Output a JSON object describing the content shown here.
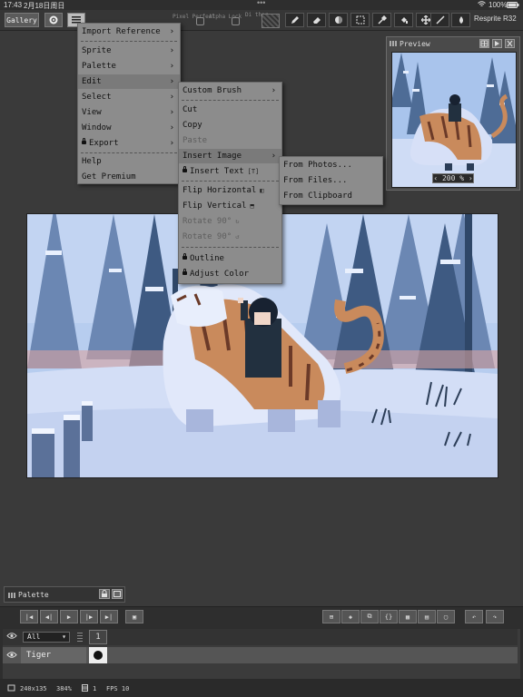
{
  "status_bar": {
    "time": "17:43",
    "date": "2月18日周日",
    "battery": "100%"
  },
  "toolbar": {
    "gallery_label": "Gallery",
    "faint_labels": [
      "Pixel Perfect",
      "Alpha Lock",
      "Di ther"
    ],
    "app_name": "Resprite R32"
  },
  "main_menu": {
    "items": [
      {
        "label": "Import Reference",
        "submenu": true
      },
      {
        "label": "Sprite",
        "submenu": true
      },
      {
        "label": "Palette",
        "submenu": true
      },
      {
        "label": "Edit",
        "submenu": true
      },
      {
        "label": "Select",
        "submenu": true
      },
      {
        "label": "View",
        "submenu": true
      },
      {
        "label": "Window",
        "submenu": true
      },
      {
        "label": "Export",
        "submenu": true,
        "locked": true
      },
      {
        "label": "Help",
        "submenu": false
      },
      {
        "label": "Get Premium",
        "submenu": false
      }
    ]
  },
  "edit_menu": {
    "items": [
      {
        "label": "Custom Brush",
        "submenu": true
      },
      {
        "label": "Cut"
      },
      {
        "label": "Copy"
      },
      {
        "label": "Paste",
        "disabled": true
      },
      {
        "label": "Insert Image",
        "submenu": true
      },
      {
        "label": "Insert Text",
        "locked": true
      },
      {
        "label": "Flip Horizontal"
      },
      {
        "label": "Flip Vertical"
      },
      {
        "label": "Rotate 90°",
        "disabled": true
      },
      {
        "label": "Rotate 90°",
        "disabled": true
      },
      {
        "label": "Outline",
        "locked": true
      },
      {
        "label": "Adjust Color",
        "locked": true
      }
    ]
  },
  "insert_image_menu": {
    "items": [
      {
        "label": "From Photos..."
      },
      {
        "label": "From Files..."
      },
      {
        "label": "From Clipboard"
      }
    ]
  },
  "preview": {
    "title": "Preview",
    "zoom": "200 %"
  },
  "palette_panel": {
    "title": "Palette"
  },
  "layers": {
    "filter": "All",
    "frame_number": "1",
    "layer_name": "Tiger"
  },
  "bottom_status": {
    "canvas_size": "240x135",
    "zoom": "384%",
    "frame_count": "1",
    "fps": "FPS 10"
  },
  "colors": {
    "menu_bg": "#8c8c8c",
    "app_bg": "#3a3a3a",
    "snow": "#d9e4f7",
    "tiger": "#c98a5c"
  }
}
